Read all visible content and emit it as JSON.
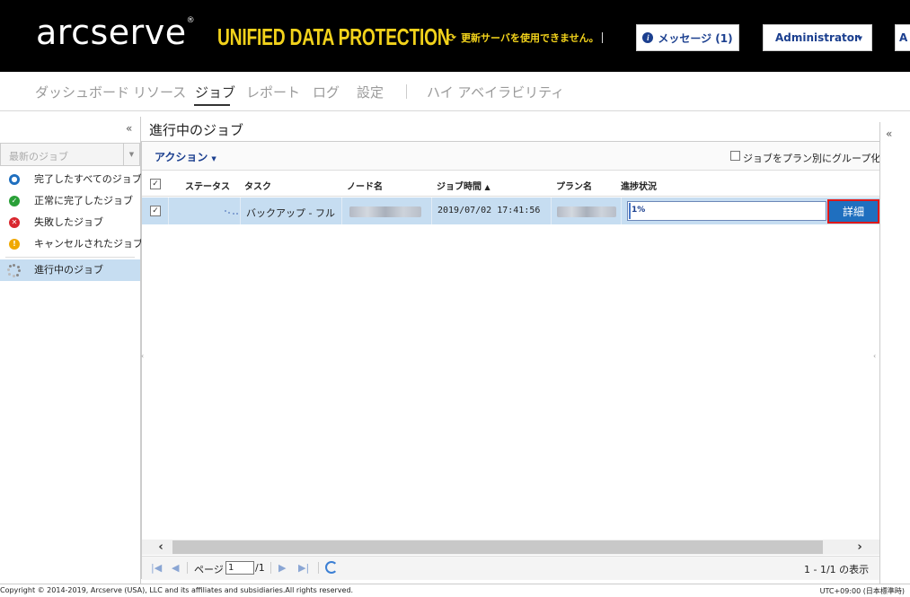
{
  "header": {
    "logo": "arcserve",
    "logo_mark": "®",
    "product": "UNIFIED DATA PROTECTION",
    "update_warning": "更新サーバを使用できません。",
    "messages_label": "メッセージ (1)",
    "user_label": "Administrator",
    "edge_label": "A"
  },
  "nav": {
    "tabs": [
      {
        "label": "ダッシュボード"
      },
      {
        "label": "リソース"
      },
      {
        "label": "ジョブ"
      },
      {
        "label": "レポート"
      },
      {
        "label": "ログ"
      },
      {
        "label": "設定"
      },
      {
        "label": "ハイ アベイラビリティ"
      }
    ],
    "active": "ジョブ"
  },
  "sidebar": {
    "filter_placeholder": "最新のジョブ",
    "items": [
      {
        "label": "完了したすべてのジョブ",
        "icon": "info-icon",
        "color": "#1f6fbf"
      },
      {
        "label": "正常に完了したジョブ",
        "icon": "check-icon",
        "color": "#2aa038"
      },
      {
        "label": "失敗したジョブ",
        "icon": "error-icon",
        "color": "#d9272e"
      },
      {
        "label": "キャンセルされたジョブ",
        "icon": "warning-icon",
        "color": "#f0a800"
      },
      {
        "label": "進行中のジョブ",
        "icon": "spinner-icon",
        "color": "#888888"
      }
    ]
  },
  "main": {
    "title": "進行中のジョブ",
    "action_label": "アクション",
    "group_by_plan_label": "ジョブをプラン別にグループ化",
    "columns": [
      "ステータス",
      "タスク",
      "ノード名",
      "ジョブ時間",
      "プラン名",
      "進捗状況"
    ],
    "sort_indicator": "▲",
    "rows": [
      {
        "checked": true,
        "task": "バックアップ - フル",
        "job_time": "2019/07/02 17:41:56",
        "progress_text": "1%",
        "progress_value": 0.01,
        "detail_label": "詳細"
      }
    ]
  },
  "pager": {
    "page_label": "ページ",
    "page_value": "1",
    "page_total": "/1",
    "range_label": "1 - 1/1 の表示"
  },
  "footer": {
    "copyright": "Copyright © 2014-2019, Arcserve (USA), LLC and its affiliates and subsidiaries.All rights reserved.",
    "timezone": "UTC+09:00 (日本標準時)"
  },
  "colors": {
    "header_bg": "#000000",
    "brand_yellow": "#f2d21b",
    "link_blue": "#1b3f8f",
    "selected_row": "#c6ddf1",
    "detail_button": "#1f6fbf",
    "highlight_border": "#e01818"
  }
}
